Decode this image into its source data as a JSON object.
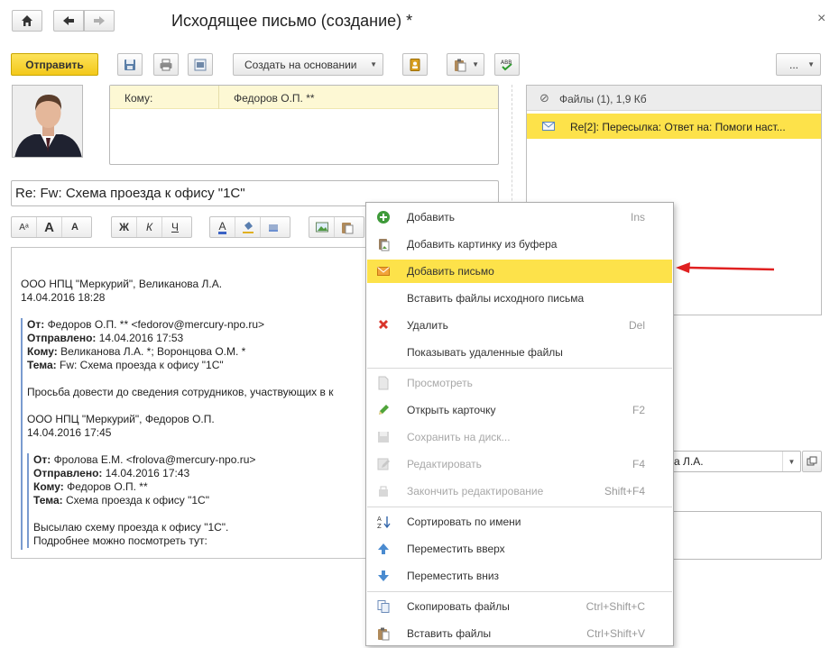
{
  "window": {
    "title": "Исходящее письмо (создание) *"
  },
  "toolbar": {
    "send_label": "Отправить",
    "create_based_label": "Создать на основании",
    "more_label": "..."
  },
  "recipient": {
    "label": "Кому:",
    "value": "Федоров О.П. **"
  },
  "subject": {
    "value": "Re: Fw: Схема проезда к офису \"1С\""
  },
  "format_toolbar": {
    "font_size_label": "Aᵃ",
    "font_grow_label": "A",
    "font_shrink_label": "A",
    "bold_label": "Ж",
    "italic_label": "К",
    "underline_label": "Ч",
    "font_color_label": "A"
  },
  "message_body": {
    "header_org": "ООО НПЦ \"Меркурий\", Великанова Л.А.",
    "header_date": "14.04.2016 18:28",
    "q1": {
      "from_label": "От:",
      "from_value": "Федоров О.П. ** <fedorov@mercury-npo.ru>",
      "sent_label": "Отправлено:",
      "sent_value": "14.04.2016 17:53",
      "to_label": "Кому:",
      "to_value": "Великанова Л.А. *; Воронцова О.М. *",
      "subject_label": "Тема:",
      "subject_value": "Fw: Схема проезда к офису \"1С\"",
      "text": "Просьба довести до сведения сотрудников, участвующих в к",
      "org": "ООО НПЦ \"Меркурий\", Федоров О.П.",
      "date": "14.04.2016 17:45"
    },
    "q2": {
      "from_label": "От:",
      "from_value": "Фролова Е.М. <frolova@mercury-npo.ru>",
      "sent_label": "Отправлено:",
      "sent_value": "14.04.2016 17:43",
      "to_label": "Кому:",
      "to_value": "Федоров О.П. **",
      "subject_label": "Тема:",
      "subject_value": "Схема проезда к офису \"1С\"",
      "text": "Высылаю схему проезда к офису \"1С\".",
      "text2": "Подробнее можно посмотреть тут:"
    }
  },
  "files_panel": {
    "header": "Файлы (1), 1,9 Кб",
    "items": [
      {
        "name": "Re[2]: Пересылка: Ответ на: Помоги наст..."
      }
    ]
  },
  "right_field": {
    "value": "а Л.А."
  },
  "context_menu": {
    "items": [
      {
        "label": "Добавить",
        "shortcut": "Ins",
        "icon": "plus-circle-icon",
        "color": "#3f9a3a"
      },
      {
        "label": "Добавить картинку из буфера",
        "shortcut": "",
        "icon": "clipboard-image-icon"
      },
      {
        "label": "Добавить письмо",
        "shortcut": "",
        "icon": "envelope-icon",
        "selected": true
      },
      {
        "label": "Вставить файлы исходного письма",
        "shortcut": ""
      },
      {
        "label": "Удалить",
        "shortcut": "Del",
        "icon": "delete-x-icon",
        "color": "#d9352b"
      },
      {
        "label": "Показывать удаленные файлы",
        "shortcut": ""
      },
      {
        "label": "Просмотреть",
        "shortcut": "",
        "icon": "document-icon",
        "disabled": true
      },
      {
        "label": "Открыть карточку",
        "shortcut": "F2",
        "icon": "pencil-icon"
      },
      {
        "label": "Сохранить на диск...",
        "shortcut": "",
        "icon": "save-icon",
        "disabled": true
      },
      {
        "label": "Редактировать",
        "shortcut": "F4",
        "icon": "edit-icon",
        "disabled": true
      },
      {
        "label": "Закончить редактирование",
        "shortcut": "Shift+F4",
        "icon": "finish-edit-icon",
        "disabled": true
      },
      {
        "label": "Сортировать по имени",
        "shortcut": "",
        "icon": "sort-az-icon"
      },
      {
        "label": "Переместить вверх",
        "shortcut": "",
        "icon": "arrow-up-icon"
      },
      {
        "label": "Переместить вниз",
        "shortcut": "",
        "icon": "arrow-down-icon"
      },
      {
        "label": "Скопировать файлы",
        "shortcut": "Ctrl+Shift+C",
        "icon": "copy-files-icon"
      },
      {
        "label": "Вставить файлы",
        "shortcut": "Ctrl+Shift+V",
        "icon": "paste-files-icon"
      }
    ]
  },
  "colors": {
    "accent_yellow": "#fde24a",
    "arrow_red": "#e02020"
  }
}
